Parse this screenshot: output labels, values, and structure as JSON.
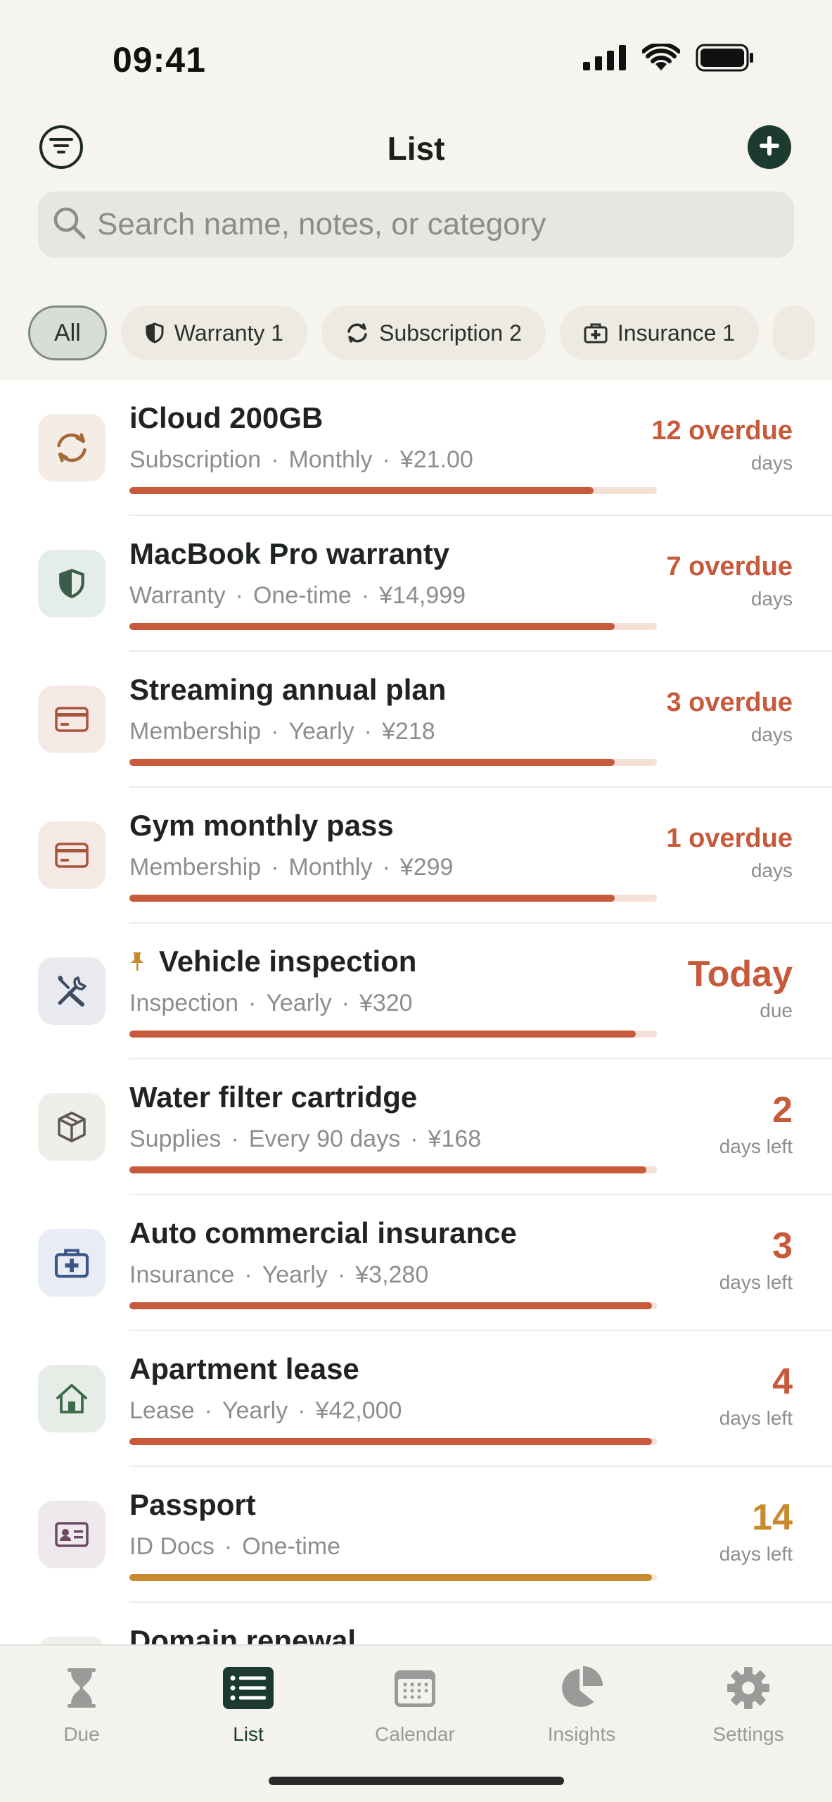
{
  "status": {
    "time": "09:41"
  },
  "nav": {
    "title": "List"
  },
  "search": {
    "placeholder": "Search name, notes, or category"
  },
  "chips": [
    {
      "label": "All",
      "icon": "all"
    },
    {
      "label": "Warranty 1",
      "icon": "shield-icon"
    },
    {
      "label": "Subscription 2",
      "icon": "refresh-icon"
    },
    {
      "label": "Insurance 1",
      "icon": "medical-briefcase-icon"
    }
  ],
  "colors": {
    "overdue": "#c65a3a",
    "warning": "#c88a2e",
    "accent": "#1d3a30"
  },
  "items": [
    {
      "title": "iCloud 200GB",
      "category": "Subscription",
      "frequency": "Monthly",
      "price": "¥21.00",
      "due_value": "12 overdue",
      "due_unit": "days",
      "progress": 0.88,
      "icon": "refresh-icon",
      "pinned": false
    },
    {
      "title": "MacBook Pro warranty",
      "category": "Warranty",
      "frequency": "One-time",
      "price": "¥14,999",
      "due_value": "7 overdue",
      "due_unit": "days",
      "progress": 0.92,
      "icon": "shield-icon",
      "pinned": false
    },
    {
      "title": "Streaming annual plan",
      "category": "Membership",
      "frequency": "Yearly",
      "price": "¥218",
      "due_value": "3 overdue",
      "due_unit": "days",
      "progress": 0.92,
      "icon": "card-icon",
      "pinned": false
    },
    {
      "title": "Gym monthly pass",
      "category": "Membership",
      "frequency": "Monthly",
      "price": "¥299",
      "due_value": "1 overdue",
      "due_unit": "days",
      "progress": 0.92,
      "icon": "card-icon",
      "pinned": false
    },
    {
      "title": "Vehicle inspection",
      "category": "Inspection",
      "frequency": "Yearly",
      "price": "¥320",
      "due_value": "Today",
      "due_unit": "due",
      "progress": 0.96,
      "icon": "tools-icon",
      "pinned": true
    },
    {
      "title": "Water filter cartridge",
      "category": "Supplies",
      "frequency": "Every 90 days",
      "price": "¥168",
      "due_value": "2",
      "due_unit": "days left",
      "progress": 0.98,
      "icon": "box-icon",
      "pinned": false
    },
    {
      "title": "Auto commercial insurance",
      "category": "Insurance",
      "frequency": "Yearly",
      "price": "¥3,280",
      "due_value": "3",
      "due_unit": "days left",
      "progress": 0.99,
      "icon": "medical-briefcase-icon",
      "pinned": false
    },
    {
      "title": "Apartment lease",
      "category": "Lease",
      "frequency": "Yearly",
      "price": "¥42,000",
      "due_value": "4",
      "due_unit": "days left",
      "progress": 0.99,
      "icon": "house-icon",
      "pinned": false
    },
    {
      "title": "Passport",
      "category": "ID Docs",
      "frequency": "One-time",
      "due_value": "14",
      "due_unit": "days left",
      "progress": 0.99,
      "icon": "id-card-icon",
      "pinned": false
    },
    {
      "title": "Domain renewal"
    }
  ],
  "tabs": [
    {
      "label": "Due",
      "icon": "hourglass-icon"
    },
    {
      "label": "List",
      "icon": "list-icon",
      "active": true
    },
    {
      "label": "Calendar",
      "icon": "calendar-icon"
    },
    {
      "label": "Insights",
      "icon": "pie-chart-icon"
    },
    {
      "label": "Settings",
      "icon": "gear-icon"
    }
  ]
}
